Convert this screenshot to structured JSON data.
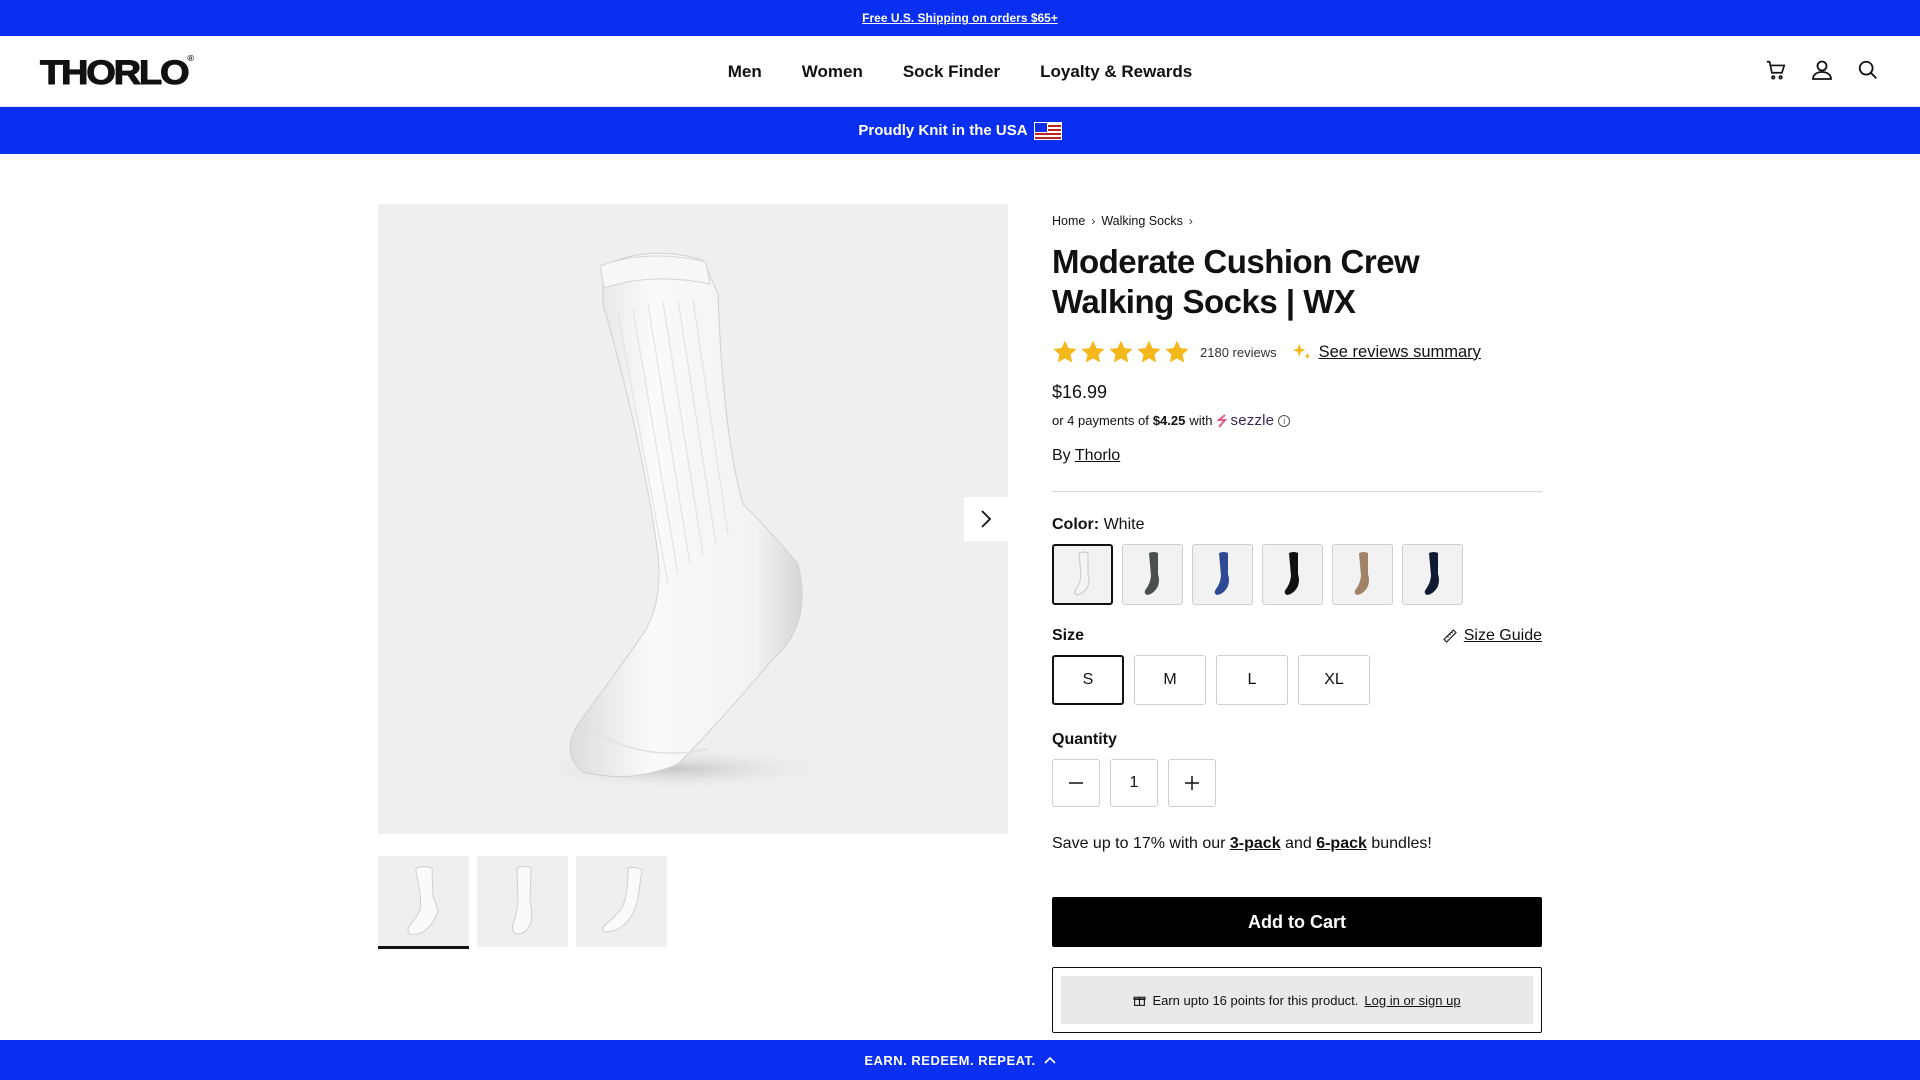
{
  "announcement": {
    "text": "Free U.S. Shipping on orders $65+"
  },
  "header": {
    "logo": "THORLO",
    "nav": [
      "Men",
      "Women",
      "Sock Finder",
      "Loyalty & Rewards"
    ],
    "icons": [
      "cart-icon",
      "account-icon",
      "search-icon"
    ]
  },
  "usa_banner": {
    "text": "Proudly Knit in the USA"
  },
  "breadcrumb": {
    "home": "Home",
    "category": "Walking Socks"
  },
  "product": {
    "title_line1": "Moderate Cushion Crew",
    "title_line2": "Walking Socks | WX",
    "rating": 5,
    "reviews": "2180 reviews",
    "reviews_summary": "See reviews summary",
    "price": "$16.99",
    "sezzle_prefix": "or 4 payments of",
    "sezzle_amount": "$4.25",
    "sezzle_with": "with",
    "sezzle_brand": "sezzle",
    "by_prefix": "By",
    "brand": "Thorlo",
    "color_label": "Color:",
    "color_value": "White",
    "colors": [
      {
        "name": "White",
        "hex": "#f4f4f4"
      },
      {
        "name": "Charcoal",
        "hex": "#4a4f50"
      },
      {
        "name": "Royal Blue",
        "hex": "#2e4a94"
      },
      {
        "name": "Black",
        "hex": "#111111"
      },
      {
        "name": "Khaki",
        "hex": "#a08468"
      },
      {
        "name": "Navy",
        "hex": "#111a33"
      }
    ],
    "size_label": "Size",
    "size_guide": "Size Guide",
    "sizes": [
      "S",
      "M",
      "L",
      "XL"
    ],
    "selected_size": "S",
    "quantity_label": "Quantity",
    "quantity": "1",
    "save_prefix": "Save up to 17% with our",
    "pack3": "3-pack",
    "save_and": "and",
    "pack6": "6-pack",
    "save_suffix": "bundles!",
    "add_to_cart": "Add to Cart",
    "earn_text": "Earn upto 16 points for this product.",
    "earn_link": "Log in or sign up"
  },
  "bottom_bar": {
    "text": "EARN. REDEEM. REPEAT."
  }
}
